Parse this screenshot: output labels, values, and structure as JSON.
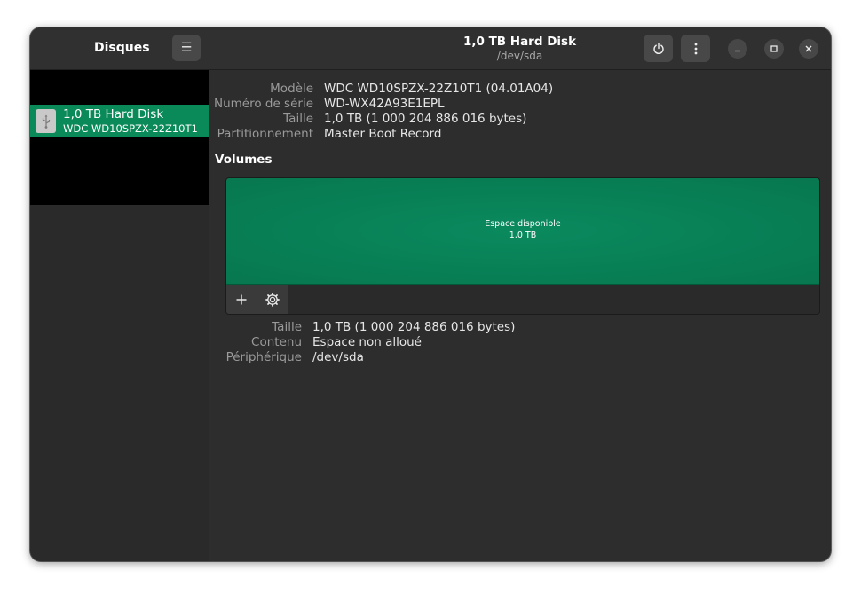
{
  "sidebar": {
    "title": "Disques",
    "devices": [
      {
        "name": "1,0 TB Hard Disk",
        "model": "WDC WD10SPZX-22Z10T1",
        "icon": "usb-drive-icon"
      }
    ]
  },
  "header": {
    "title": "1,0 TB Hard Disk",
    "subtitle": "/dev/sda",
    "icons": {
      "menu": "hamburger-menu-icon",
      "power": "power-icon",
      "more": "kebab-menu-icon",
      "minimize": "minimize-icon",
      "maximize": "maximize-icon",
      "close": "close-icon"
    }
  },
  "drive_info": [
    {
      "label": "Modèle",
      "value": "WDC WD10SPZX-22Z10T1 (04.01A04)"
    },
    {
      "label": "Numéro de série",
      "value": "WD-WX42A93E1EPL"
    },
    {
      "label": "Taille",
      "value": "1,0 TB (1 000 204 886 016 bytes)"
    },
    {
      "label": "Partitionnement",
      "value": "Master Boot Record"
    }
  ],
  "volumes": {
    "title": "Volumes",
    "partition": {
      "label": "Espace disponible",
      "size": "1,0 TB"
    },
    "toolbar_icons": [
      "plus-icon",
      "gear-icon"
    ]
  },
  "volume_info": [
    {
      "label": "Taille",
      "value": "1,0 TB (1 000 204 886 016 bytes)"
    },
    {
      "label": "Contenu",
      "value": "Espace non alloué"
    },
    {
      "label": "Périphérique",
      "value": "/dev/sda"
    }
  ],
  "colors": {
    "accent": "#0a8a58",
    "window_bg": "#2d2d2d",
    "device_list_bg": "#000000"
  }
}
